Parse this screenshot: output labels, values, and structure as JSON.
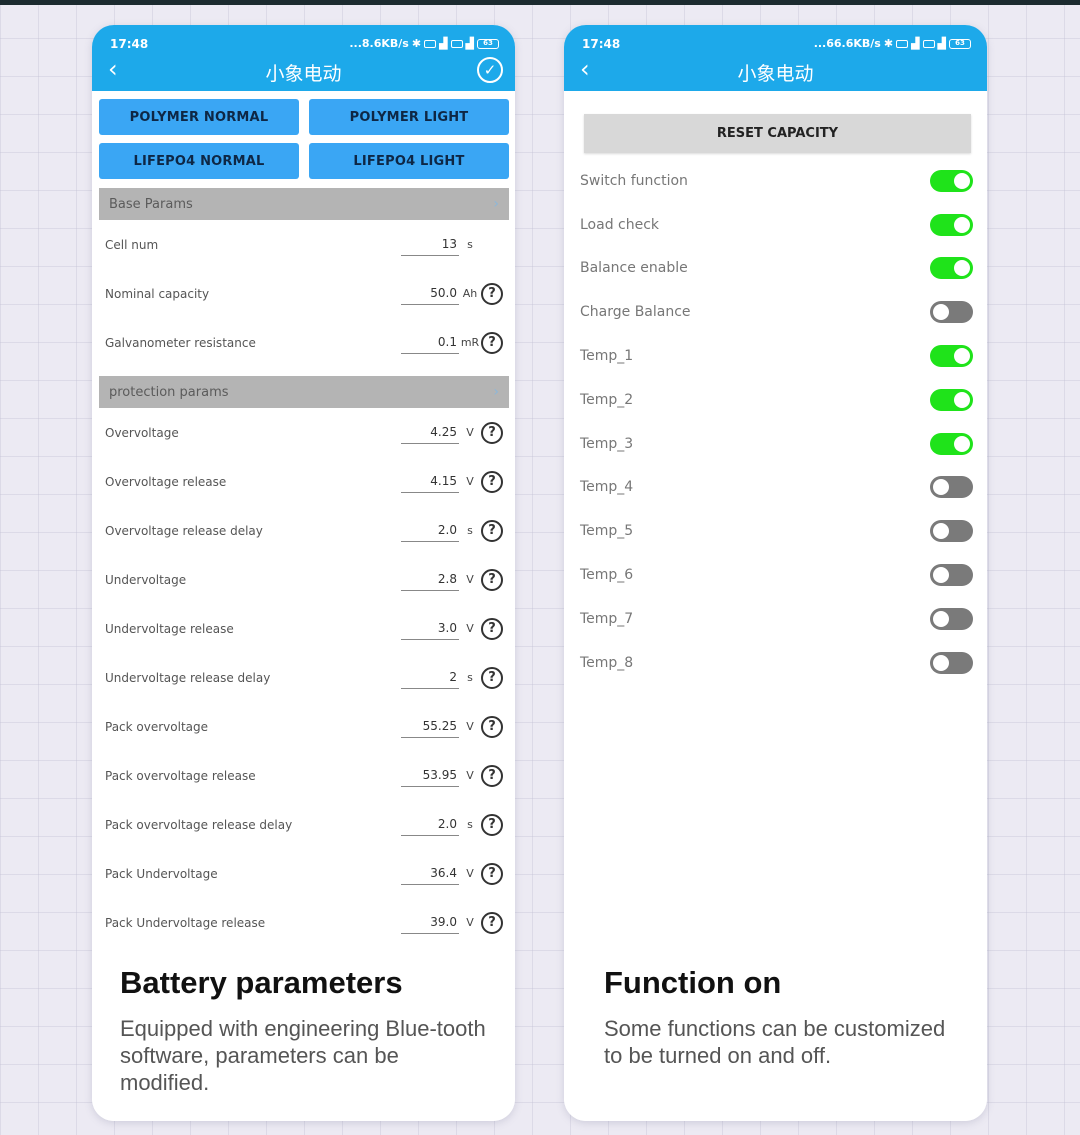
{
  "left_phone": {
    "status": {
      "time": "17:48",
      "network_speed": "...8.6KB/s",
      "battery": "63"
    },
    "nav": {
      "back_icon": "chevron-left-icon",
      "title": "小象电动",
      "confirm_icon": "check-circle-icon"
    },
    "presets": [
      {
        "label": "POLYMER NORMAL"
      },
      {
        "label": "POLYMER LIGHT"
      },
      {
        "label": "LIFEPO4 NORMAL"
      },
      {
        "label": "LIFEPO4 LIGHT"
      }
    ],
    "base_section": {
      "title": "Base Params",
      "params": [
        {
          "label": "Cell num",
          "value": "13",
          "unit": "s",
          "help": false
        },
        {
          "label": "Nominal capacity",
          "value": "50.0",
          "unit": "Ah",
          "help": true
        },
        {
          "label": "Galvanometer resistance",
          "value": "0.1",
          "unit": "mR",
          "help": true
        }
      ]
    },
    "protection_section": {
      "title": "protection params",
      "params": [
        {
          "label": "Overvoltage",
          "value": "4.25",
          "unit": "V",
          "help": true
        },
        {
          "label": "Overvoltage release",
          "value": "4.15",
          "unit": "V",
          "help": true
        },
        {
          "label": "Overvoltage release delay",
          "value": "2.0",
          "unit": "s",
          "help": true
        },
        {
          "label": "Undervoltage",
          "value": "2.8",
          "unit": "V",
          "help": true
        },
        {
          "label": "Undervoltage release",
          "value": "3.0",
          "unit": "V",
          "help": true
        },
        {
          "label": "Undervoltage release delay",
          "value": "2",
          "unit": "s",
          "help": true
        },
        {
          "label": "Pack overvoltage",
          "value": "55.25",
          "unit": "V",
          "help": true
        },
        {
          "label": "Pack overvoltage release",
          "value": "53.95",
          "unit": "V",
          "help": true
        },
        {
          "label": "Pack overvoltage release delay",
          "value": "2.0",
          "unit": "s",
          "help": true
        },
        {
          "label": "Pack Undervoltage",
          "value": "36.4",
          "unit": "V",
          "help": true
        },
        {
          "label": "Pack Undervoltage release",
          "value": "39.0",
          "unit": "V",
          "help": true
        }
      ]
    },
    "caption": {
      "title": "Battery parameters",
      "body": "Equipped with engineering Blue-tooth software, parameters can be modified."
    }
  },
  "right_phone": {
    "status": {
      "time": "17:48",
      "network_speed": "...66.6KB/s",
      "battery": "63"
    },
    "nav": {
      "back_icon": "chevron-left-icon",
      "title": "小象电动"
    },
    "reset_button": "RESET CAPACITY",
    "toggles": [
      {
        "label": "Switch function",
        "on": true
      },
      {
        "label": "Load check",
        "on": true
      },
      {
        "label": "Balance enable",
        "on": true
      },
      {
        "label": "Charge Balance",
        "on": false
      },
      {
        "label": "Temp_1",
        "on": true
      },
      {
        "label": "Temp_2",
        "on": true
      },
      {
        "label": "Temp_3",
        "on": true
      },
      {
        "label": "Temp_4",
        "on": false
      },
      {
        "label": "Temp_5",
        "on": false
      },
      {
        "label": "Temp_6",
        "on": false
      },
      {
        "label": "Temp_7",
        "on": false
      },
      {
        "label": "Temp_8",
        "on": false
      }
    ],
    "caption": {
      "title": "Function on",
      "body": "Some functions can be customized to be turned on and off."
    }
  },
  "colors": {
    "header_blue": "#1da9ea",
    "preset_blue": "#3aa6f4",
    "toggle_on": "#1fe31a",
    "toggle_off": "#7a7a7a",
    "section_gray": "#b4b4b4"
  }
}
